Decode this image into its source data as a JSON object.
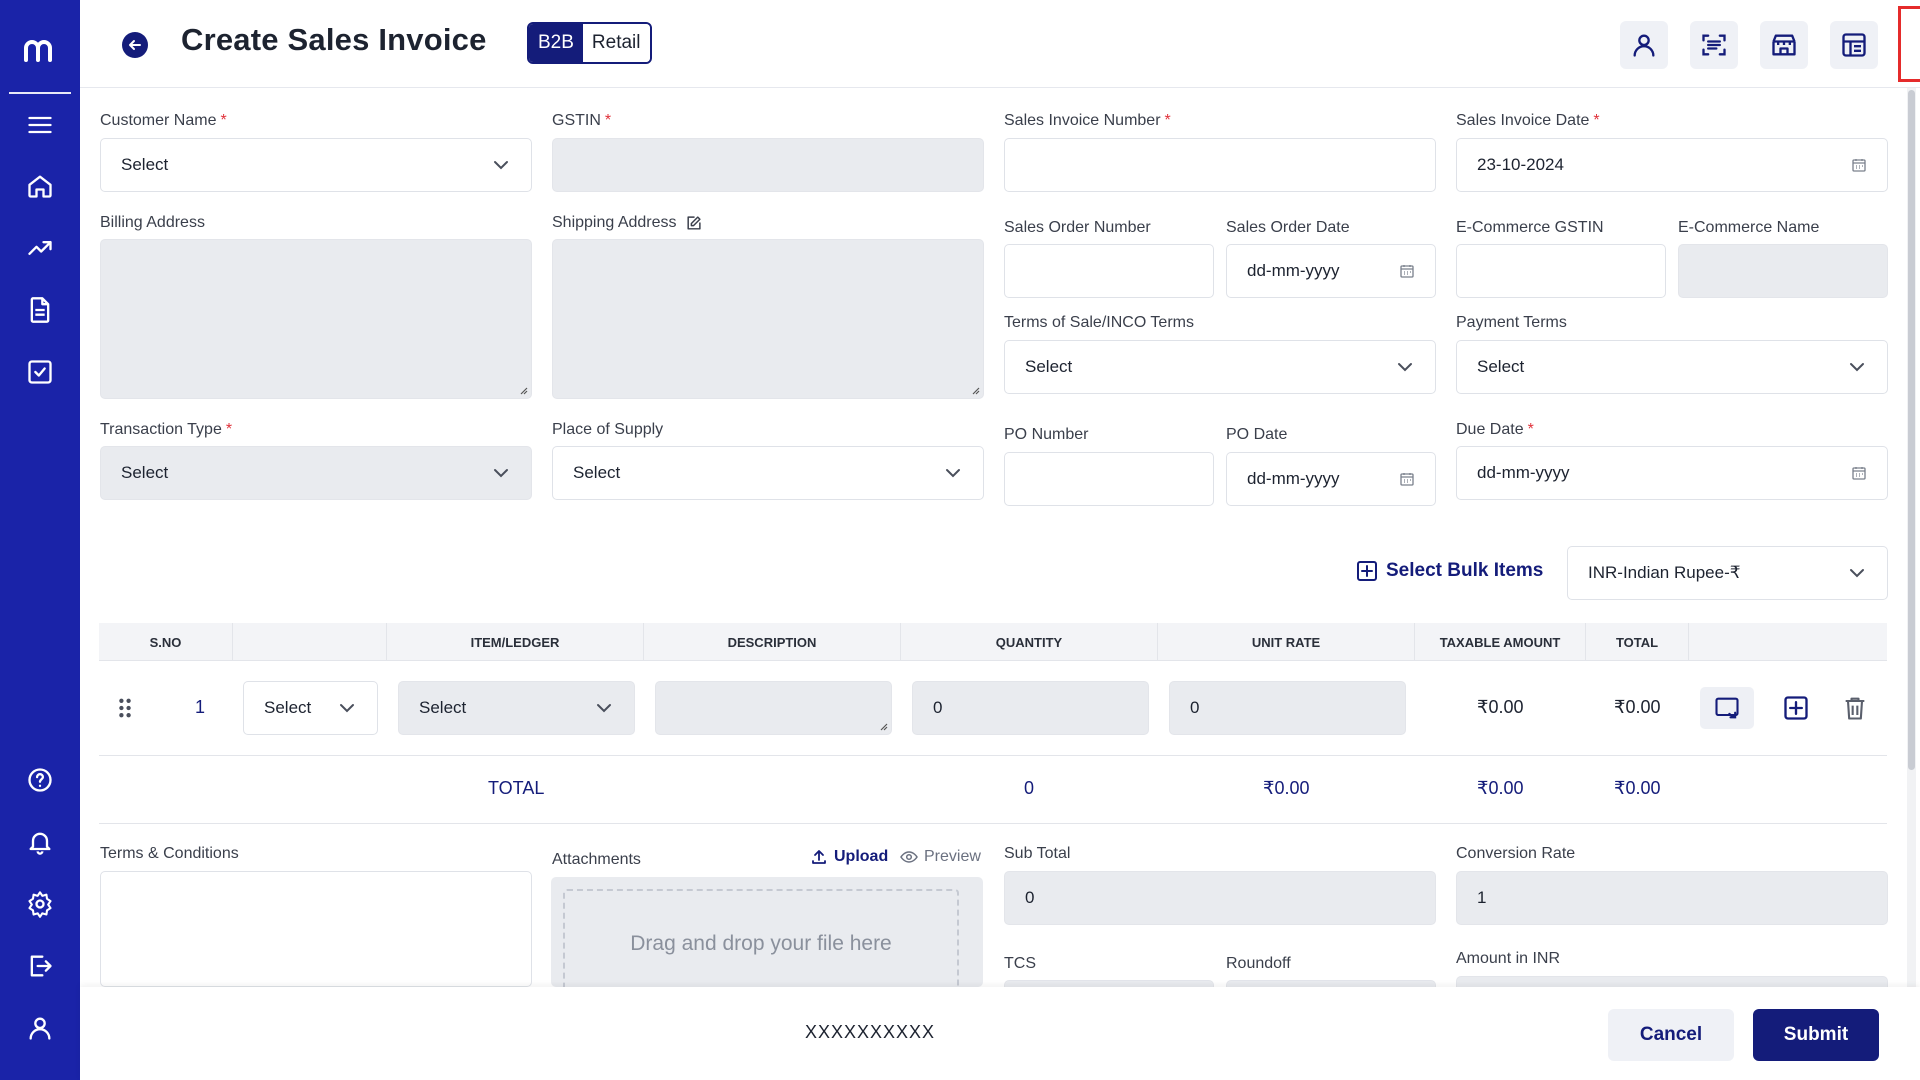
{
  "header": {
    "title": "Create Sales Invoice",
    "segment": {
      "active": "B2B",
      "inactive": "Retail"
    }
  },
  "form": {
    "customer_name": {
      "label": "Customer Name",
      "value": "Select"
    },
    "gstin": {
      "label": "GSTIN",
      "value": ""
    },
    "invoice_number": {
      "label": "Sales Invoice Number",
      "value": ""
    },
    "invoice_date": {
      "label": "Sales Invoice Date",
      "value": "23-10-2024"
    },
    "billing_address": {
      "label": "Billing Address"
    },
    "shipping_address": {
      "label": "Shipping Address"
    },
    "sales_order_number": {
      "label": "Sales Order Number",
      "value": ""
    },
    "sales_order_date": {
      "label": "Sales Order Date",
      "value": "dd-mm-yyyy"
    },
    "ecommerce_gstin": {
      "label": "E-Commerce GSTIN",
      "value": ""
    },
    "ecommerce_name": {
      "label": "E-Commerce Name",
      "value": ""
    },
    "terms_of_sale": {
      "label": "Terms of Sale/INCO Terms",
      "value": "Select"
    },
    "payment_terms": {
      "label": "Payment Terms",
      "value": "Select"
    },
    "transaction_type": {
      "label": "Transaction Type",
      "value": "Select"
    },
    "place_of_supply": {
      "label": "Place of Supply",
      "value": "Select"
    },
    "po_number": {
      "label": "PO Number",
      "value": ""
    },
    "po_date": {
      "label": "PO Date",
      "value": "dd-mm-yyyy"
    },
    "due_date": {
      "label": "Due Date",
      "value": "dd-mm-yyyy"
    }
  },
  "items": {
    "bulk_label": "Select Bulk Items",
    "currency": "INR-Indian Rupee-₹",
    "columns": [
      "S.NO",
      "ITEM/LEDGER",
      "DESCRIPTION",
      "QUANTITY",
      "UNIT RATE",
      "TAXABLE AMOUNT",
      "TOTAL"
    ],
    "rows": [
      {
        "sno": "1",
        "type": "Select",
        "item": "Select",
        "description": "",
        "quantity": "0",
        "unit_rate": "0",
        "taxable_amount": "₹0.00",
        "total": "₹0.00"
      }
    ],
    "totals": {
      "label": "TOTAL",
      "quantity": "0",
      "unit_rate": "₹0.00",
      "taxable_amount": "₹0.00",
      "total": "₹0.00"
    }
  },
  "bottom": {
    "terms_label": "Terms & Conditions",
    "attachments_label": "Attachments",
    "upload_label": "Upload",
    "preview_label": "Preview",
    "dropzone_text": "Drag and drop your file here",
    "sub_total": {
      "label": "Sub Total",
      "value": "0"
    },
    "conversion_rate": {
      "label": "Conversion Rate",
      "value": "1"
    },
    "tcs_label": "TCS",
    "roundoff_label": "Roundoff",
    "amount_inr_label": "Amount in INR"
  },
  "footer": {
    "id_text": "XXXXXXXXXX",
    "cancel_label": "Cancel",
    "submit_label": "Submit"
  },
  "colors": {
    "brand": "#1a23a8",
    "primary": "#141c7a",
    "required": "#e0313a",
    "highlight": "#e52b2b"
  }
}
